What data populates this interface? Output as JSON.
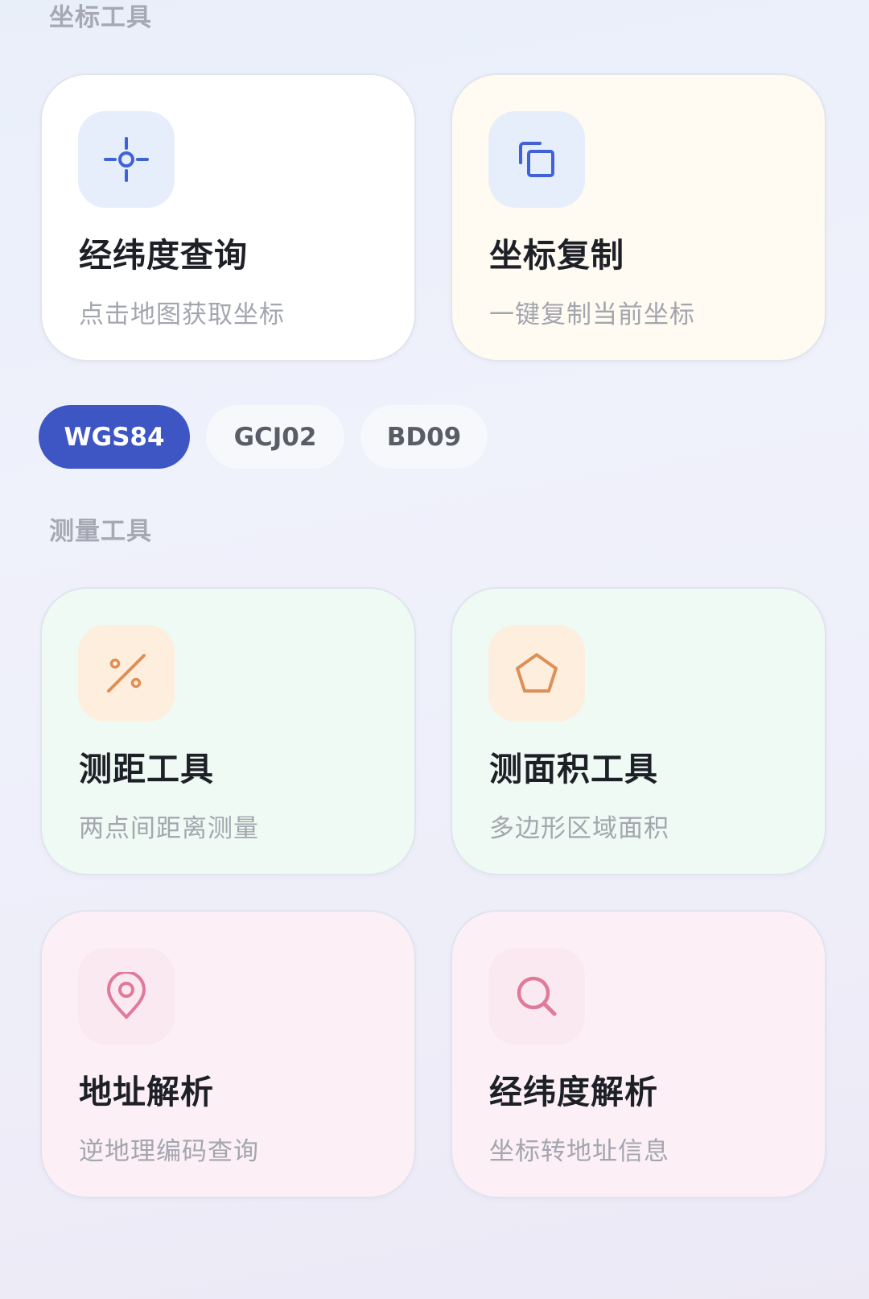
{
  "sections": {
    "coordinate_tools": "坐标工具",
    "measure_tools": "测量工具"
  },
  "cards": {
    "latlng_query": {
      "title": "经纬度查询",
      "subtitle": "点击地图获取坐标",
      "icon": "crosshair-icon"
    },
    "coord_copy": {
      "title": "坐标复制",
      "subtitle": "一键复制当前坐标",
      "icon": "copy-icon"
    },
    "distance": {
      "title": "测距工具",
      "subtitle": "两点间距离测量",
      "icon": "distance-icon"
    },
    "area": {
      "title": "测面积工具",
      "subtitle": "多边形区域面积",
      "icon": "pentagon-icon"
    },
    "address_parse": {
      "title": "地址解析",
      "subtitle": "逆地理编码查询",
      "icon": "location-pin-icon"
    },
    "latlng_parse": {
      "title": "经纬度解析",
      "subtitle": "坐标转地址信息",
      "icon": "search-icon"
    }
  },
  "coord_systems": {
    "selected": "WGS84",
    "options": [
      "WGS84",
      "GCJ02",
      "BD09"
    ]
  },
  "colors": {
    "accent": "#3e56c4",
    "icon_blue": "#3f63d6",
    "icon_orange": "#de8f57",
    "icon_pink": "#e07a98"
  }
}
